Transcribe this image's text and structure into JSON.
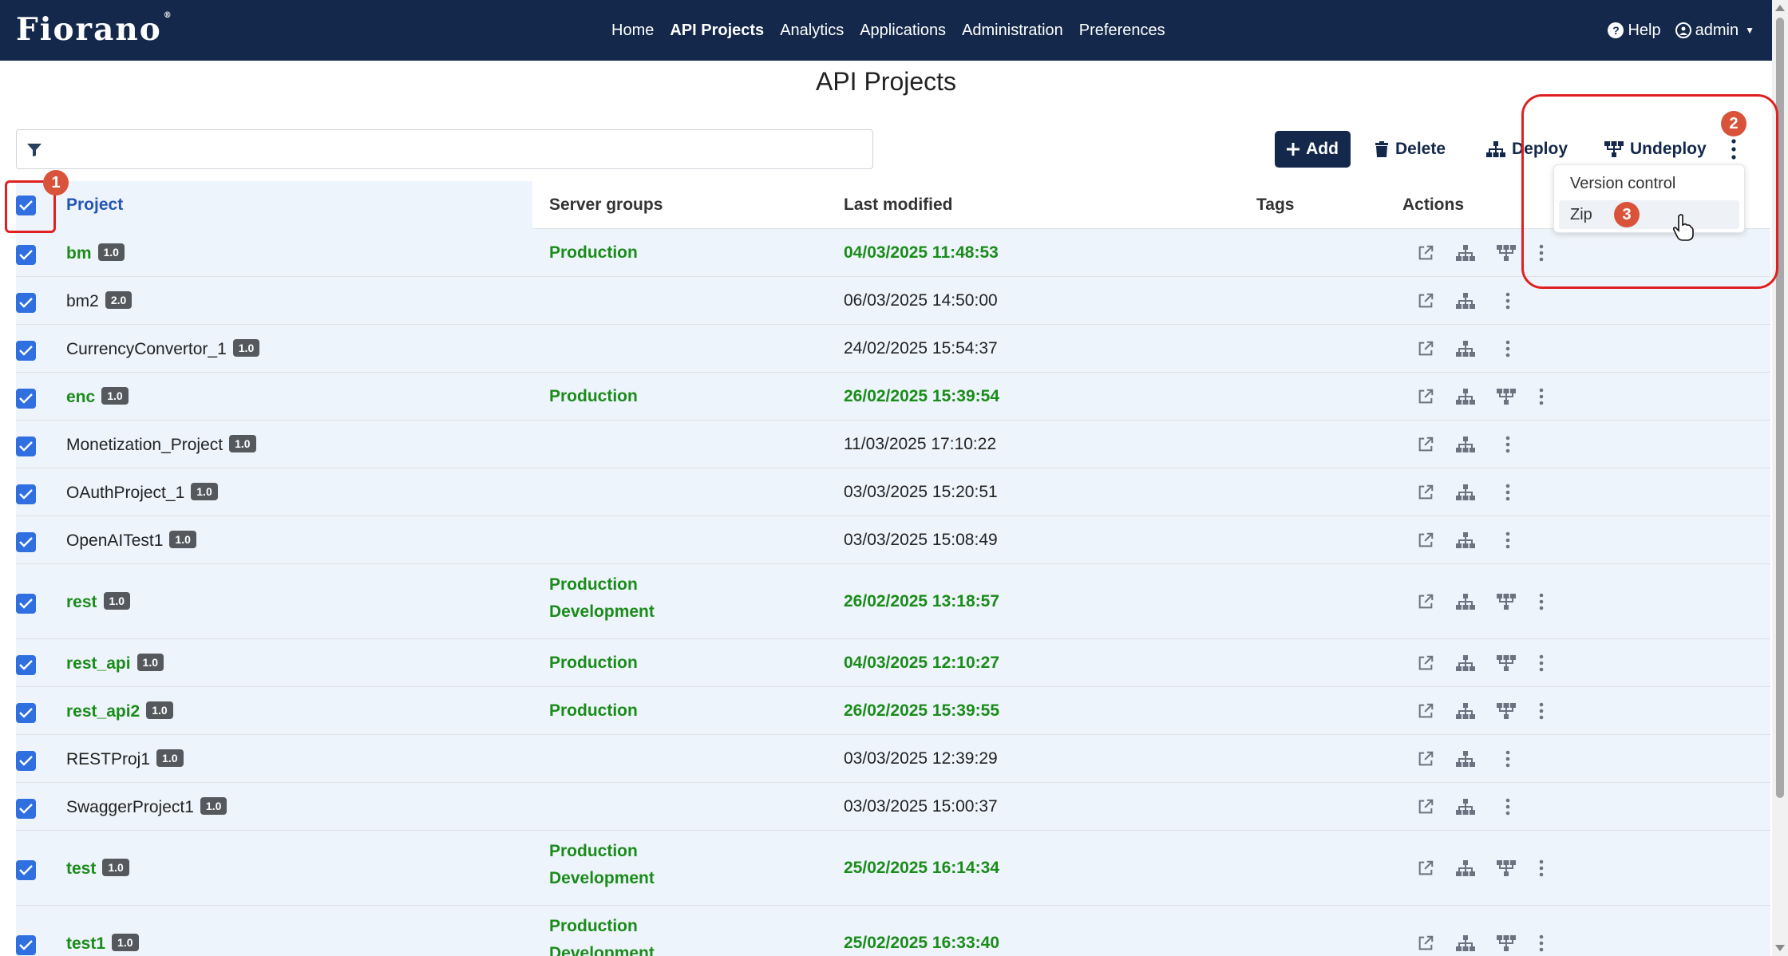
{
  "navbar": {
    "logo": "Fiorano",
    "logo_mark": "®",
    "items": [
      {
        "label": "Home",
        "active": false
      },
      {
        "label": "API Projects",
        "active": true
      },
      {
        "label": "Analytics",
        "active": false
      },
      {
        "label": "Applications",
        "active": false
      },
      {
        "label": "Administration",
        "active": false
      },
      {
        "label": "Preferences",
        "active": false
      }
    ],
    "help_label": "Help",
    "user_label": "admin"
  },
  "page": {
    "title": "API Projects"
  },
  "filter": {
    "placeholder": ""
  },
  "toolbar": {
    "add_label": "Add",
    "delete_label": "Delete",
    "deploy_label": "Deploy",
    "undeploy_label": "Undeploy"
  },
  "more_menu": {
    "items": [
      "Version control",
      "Zip"
    ],
    "hovered": "Zip"
  },
  "table": {
    "headers": {
      "project": "Project",
      "server_groups": "Server groups",
      "last_modified": "Last modified",
      "tags": "Tags",
      "actions": "Actions"
    },
    "rows": [
      {
        "name": "bm",
        "version": "1.0",
        "groups": [
          "Production"
        ],
        "modified": "04/03/2025 11:48:53",
        "deployed": true
      },
      {
        "name": "bm2",
        "version": "2.0",
        "groups": [],
        "modified": "06/03/2025 14:50:00",
        "deployed": false
      },
      {
        "name": "CurrencyConvertor_1",
        "version": "1.0",
        "groups": [],
        "modified": "24/02/2025 15:54:37",
        "deployed": false
      },
      {
        "name": "enc",
        "version": "1.0",
        "groups": [
          "Production"
        ],
        "modified": "26/02/2025 15:39:54",
        "deployed": true
      },
      {
        "name": "Monetization_Project",
        "version": "1.0",
        "groups": [],
        "modified": "11/03/2025 17:10:22",
        "deployed": false
      },
      {
        "name": "OAuthProject_1",
        "version": "1.0",
        "groups": [],
        "modified": "03/03/2025 15:20:51",
        "deployed": false
      },
      {
        "name": "OpenAITest1",
        "version": "1.0",
        "groups": [],
        "modified": "03/03/2025 15:08:49",
        "deployed": false
      },
      {
        "name": "rest",
        "version": "1.0",
        "groups": [
          "Production",
          "Development"
        ],
        "modified": "26/02/2025 13:18:57",
        "deployed": true
      },
      {
        "name": "rest_api",
        "version": "1.0",
        "groups": [
          "Production"
        ],
        "modified": "04/03/2025 12:10:27",
        "deployed": true
      },
      {
        "name": "rest_api2",
        "version": "1.0",
        "groups": [
          "Production"
        ],
        "modified": "26/02/2025 15:39:55",
        "deployed": true
      },
      {
        "name": "RESTProj1",
        "version": "1.0",
        "groups": [],
        "modified": "03/03/2025 12:39:29",
        "deployed": false
      },
      {
        "name": "SwaggerProject1",
        "version": "1.0",
        "groups": [],
        "modified": "03/03/2025 15:00:37",
        "deployed": false
      },
      {
        "name": "test",
        "version": "1.0",
        "groups": [
          "Production",
          "Development"
        ],
        "modified": "25/02/2025 16:14:34",
        "deployed": true
      },
      {
        "name": "test1",
        "version": "1.0",
        "groups": [
          "Production",
          "Development"
        ],
        "modified": "25/02/2025 16:33:40",
        "deployed": true
      }
    ]
  },
  "annotations": {
    "step1": "1",
    "step2": "2",
    "step3": "3"
  },
  "colors": {
    "navbar": "#13284a",
    "deployed_text": "#1a8c1a",
    "checkbox": "#2f6fe0",
    "highlight": "#e02020",
    "step_badge": "#d9533a"
  }
}
